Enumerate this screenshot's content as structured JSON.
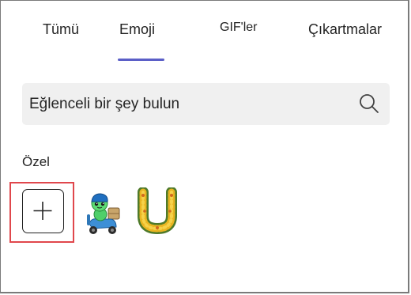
{
  "tabs": [
    {
      "label": "Tümü"
    },
    {
      "label": "Emoji",
      "active": true
    },
    {
      "label": "GIF'ler"
    },
    {
      "label": "Çıkartmalar"
    }
  ],
  "accent_color": "#5b5fc7",
  "search": {
    "placeholder": "Eğlenceli bir şey bulun",
    "icon": "search-icon"
  },
  "section": {
    "label": "Özel"
  },
  "custom_emojis": [
    {
      "icon": "add-icon",
      "action": "add custom emoji"
    },
    {
      "icon": "scooter-delivery-character-icon"
    },
    {
      "icon": "flower-garland-letter-u-icon"
    }
  ],
  "highlight_color": "#e0474c"
}
